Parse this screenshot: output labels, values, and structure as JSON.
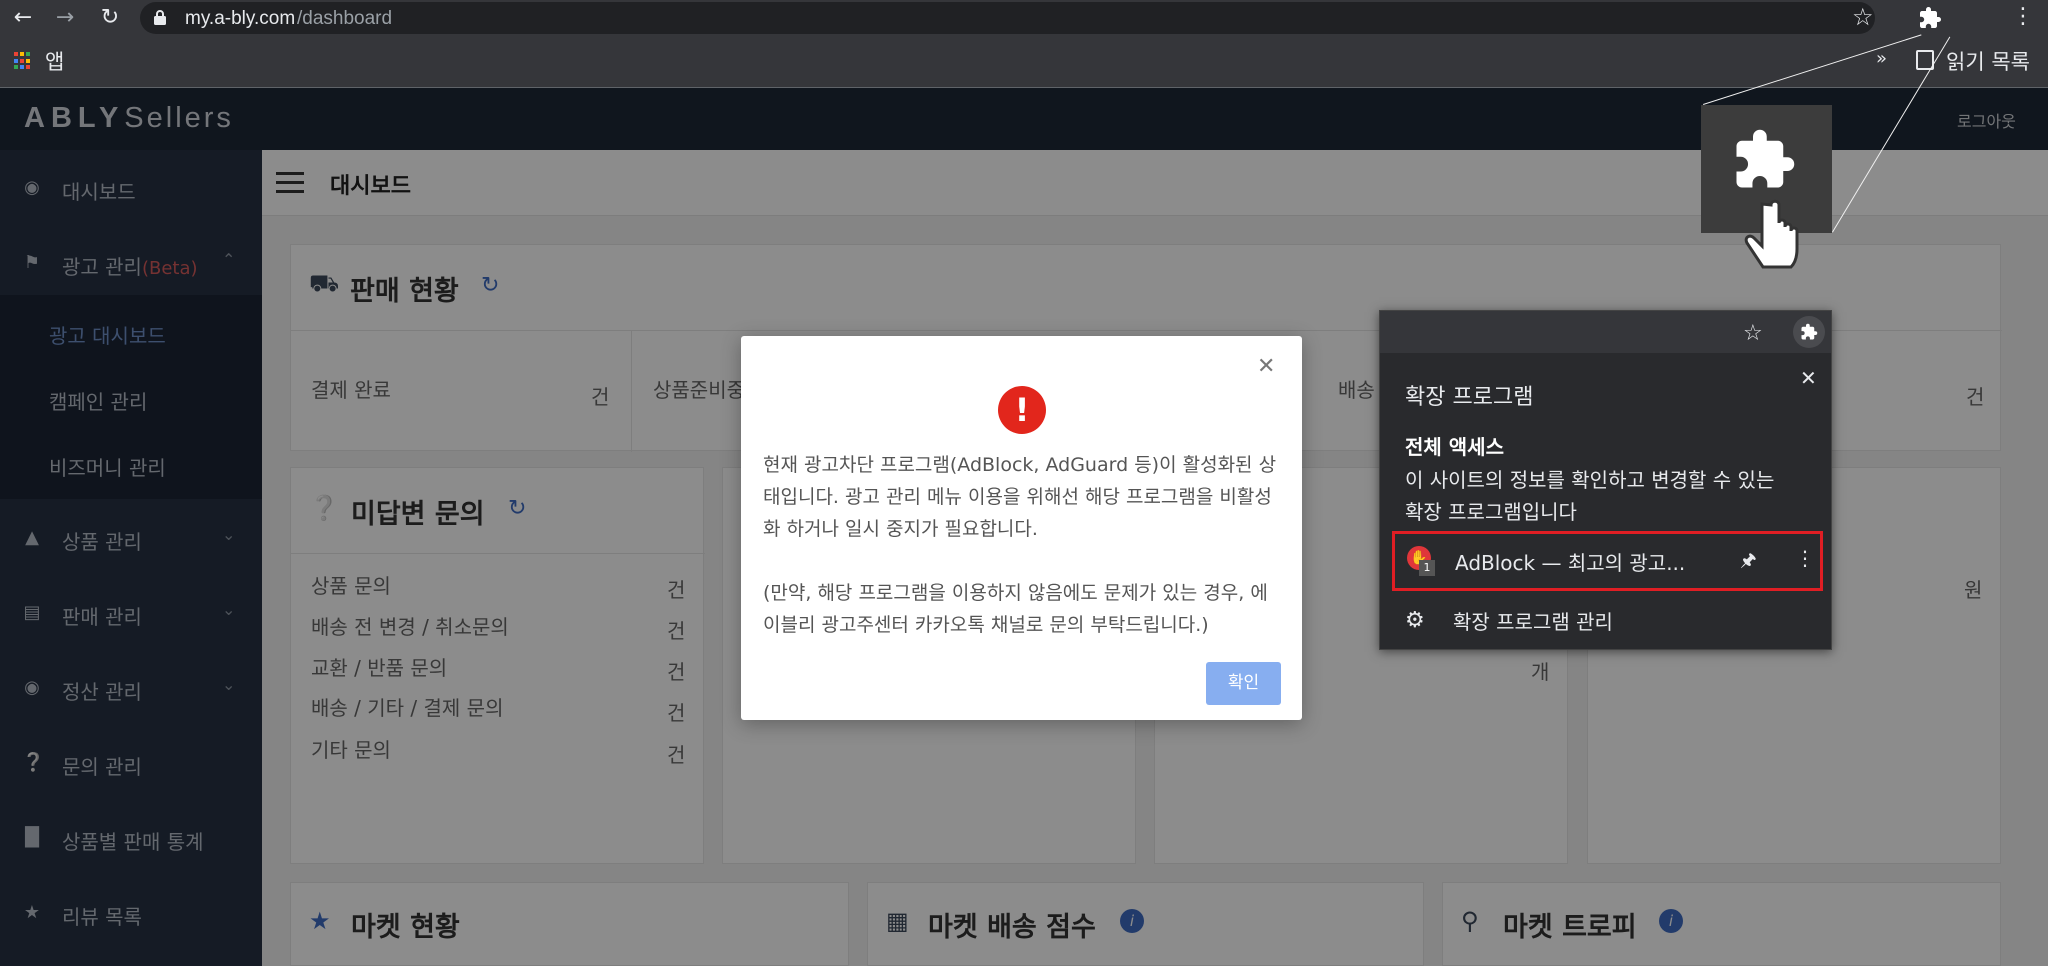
{
  "browser": {
    "url_host": "my.a-bly.com",
    "url_path": "/dashboard",
    "apps_label": "앱",
    "overflow_label": "»",
    "reading_list_label": "읽기 목록"
  },
  "header": {
    "logo_brand": "ABLY",
    "logo_suffix": "Sellers",
    "logout_label": "로그아웃"
  },
  "sidebar": {
    "items": [
      {
        "label": "대시보드",
        "icon": "dashboard-gauge-icon"
      },
      {
        "label": "광고 관리",
        "badge": "(Beta)",
        "icon": "flag-icon"
      },
      {
        "label": "상품 관리",
        "icon": "shirt-icon"
      },
      {
        "label": "판매 관리",
        "icon": "invoice-icon"
      },
      {
        "label": "정산 관리",
        "icon": "settlement-icon"
      },
      {
        "label": "문의 관리",
        "icon": "question-icon"
      },
      {
        "label": "상품별 판매 통계",
        "icon": "bar-chart-icon"
      },
      {
        "label": "리뷰 목록",
        "icon": "star-icon"
      }
    ],
    "sub_items": [
      {
        "label": "광고 대시보드",
        "active": true
      },
      {
        "label": "캠페인 관리"
      },
      {
        "label": "비즈머니 관리"
      }
    ]
  },
  "topbar": {
    "title": "대시보드"
  },
  "cards": {
    "sales": {
      "title": "판매 현황",
      "col1_label": "결제 완료",
      "col1_unit": "건",
      "col2_label": "상품준비중",
      "col3_label": "배송",
      "last_unit": "건"
    },
    "inquiries": {
      "title": "미답변 문의",
      "rows": [
        {
          "label": "상품 문의",
          "unit": "건"
        },
        {
          "label": "배송 전 변경 / 취소문의",
          "unit": "건"
        },
        {
          "label": "교환 / 반품 문의",
          "unit": "건"
        },
        {
          "label": "배송 / 기타 / 결제 문의",
          "unit": "건"
        },
        {
          "label": "기타 문의",
          "unit": "건"
        }
      ]
    },
    "middle_unit": "개",
    "right_unit": "원",
    "market_status": {
      "title": "마켓 현황"
    },
    "market_shipping": {
      "title": "마켓 배송 점수"
    },
    "market_trophy": {
      "title": "마켓 트로피"
    }
  },
  "modal": {
    "paragraph1": "현재 광고차단 프로그램(AdBlock, AdGuard 등)이 활성화된 상태입니다. 광고 관리 메뉴 이용을 위해선 해당 프로그램을 비활성화 하거나 일시 중지가 필요합니다.",
    "paragraph2": "(만약, 해당 프로그램을 이용하지 않음에도 문제가 있는 경우, 에이블리 광고주센터 카카오톡 채널로 문의 부탁드립니다.)",
    "confirm_label": "확인",
    "alert_symbol": "!"
  },
  "extensions_popup": {
    "title": "확장 프로그램",
    "full_access_label": "전체 액세스",
    "description_line1": "이 사이트의 정보를 확인하고 변경할 수 있는",
    "description_line2": "확장 프로그램입니다",
    "extensions": [
      {
        "name": "AdBlock — 최고의 광고...",
        "badge": "1",
        "highlighted": true
      }
    ],
    "manage_label": "확장 프로그램 관리"
  },
  "colors": {
    "accent_blue": "#3f6cc3",
    "alert_red": "#e2261c",
    "highlight_red": "#e01e24",
    "confirm_button": "#87aef0"
  }
}
